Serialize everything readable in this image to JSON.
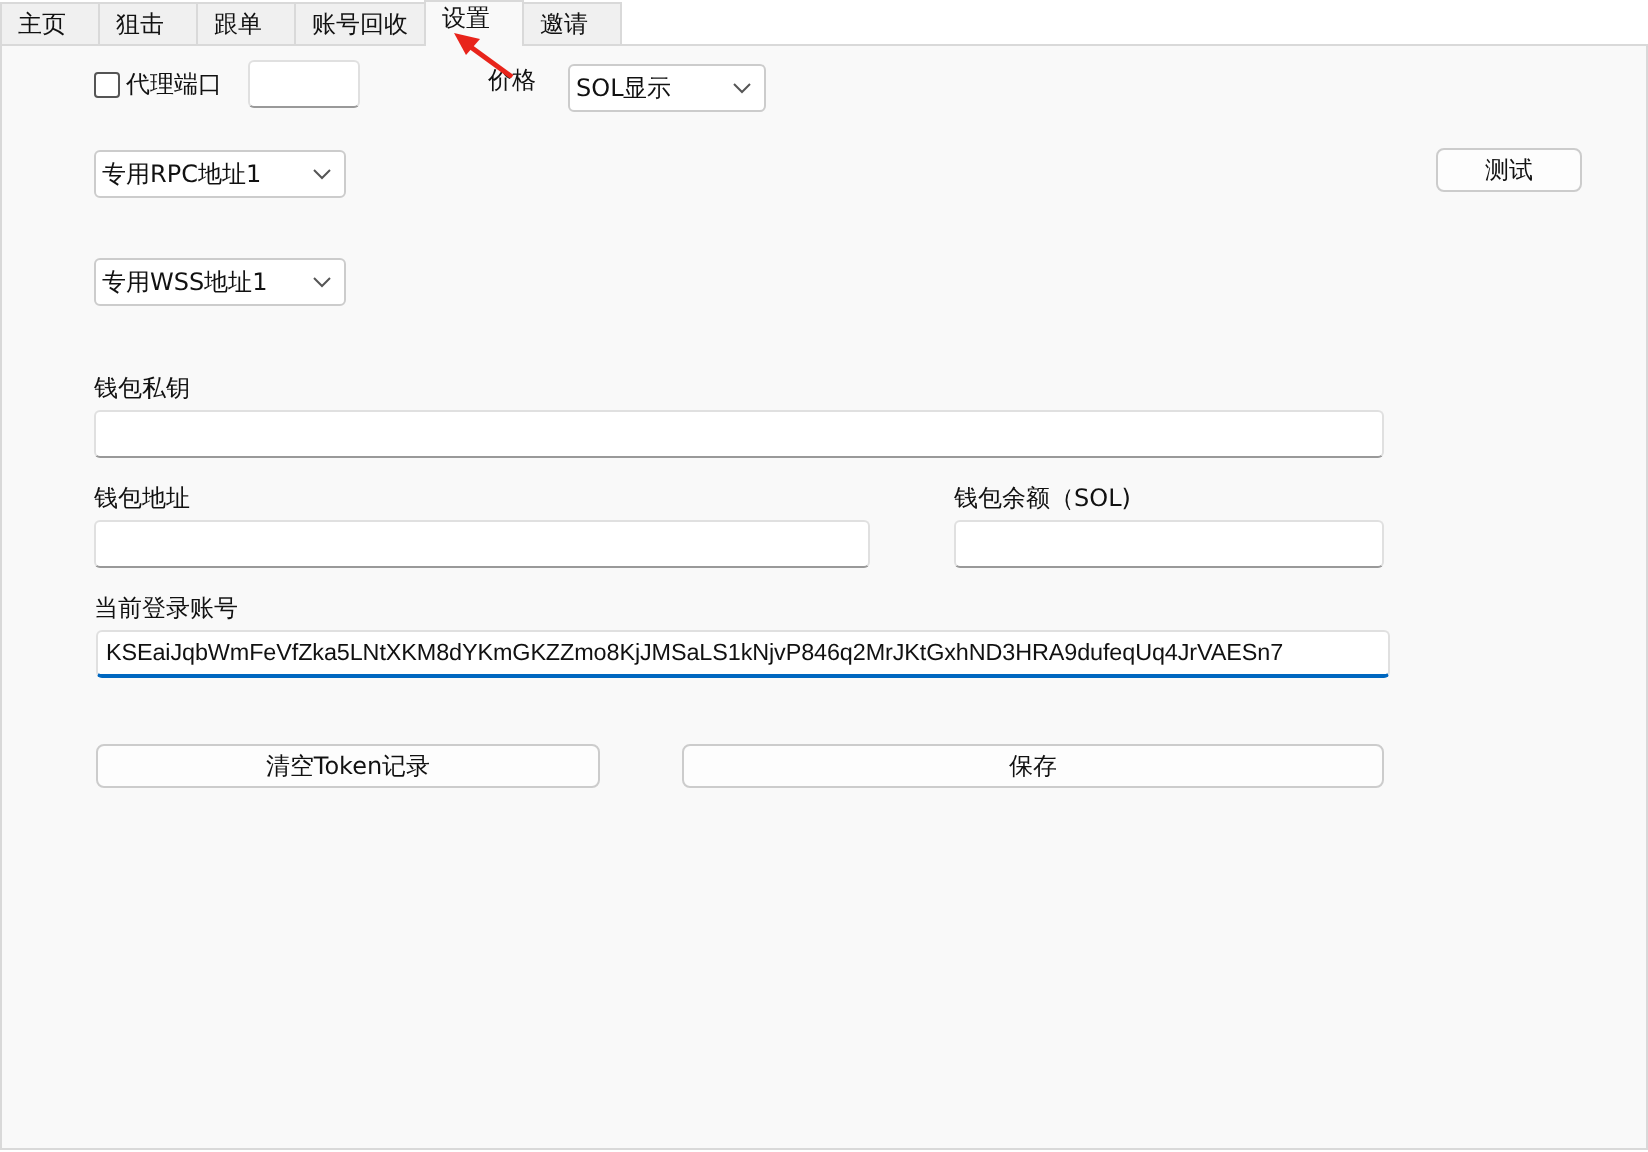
{
  "tabs": [
    {
      "label": "主页",
      "selected": false
    },
    {
      "label": "狙击",
      "selected": false
    },
    {
      "label": "跟单",
      "selected": false
    },
    {
      "label": "账号回收",
      "selected": false
    },
    {
      "label": "设置",
      "selected": true
    },
    {
      "label": "邀请",
      "selected": false
    }
  ],
  "proxy": {
    "label": "代理端口",
    "checked": false
  },
  "price": {
    "label": "价格",
    "value": "SOL显示"
  },
  "rpc_select": {
    "value": "专用RPC地址1"
  },
  "test_button": "测试",
  "wss_select": {
    "value": "专用WSS地址1"
  },
  "private_key": {
    "label": "钱包私钥"
  },
  "wallet_address": {
    "label": "钱包地址"
  },
  "wallet_balance": {
    "label": "钱包余额（SOL)"
  },
  "account": {
    "label": "当前登录账号",
    "value": "KSEaiJqbWmFeVfZka5LNtXKM8dYKmGKZZmo8KjJMSaLS1kNjvP846q2MrJKtGxhND3HRA9dufeqUq4JrVAESn7",
    "focused": true
  },
  "buttons": [
    "清空Token记录",
    "保存"
  ]
}
